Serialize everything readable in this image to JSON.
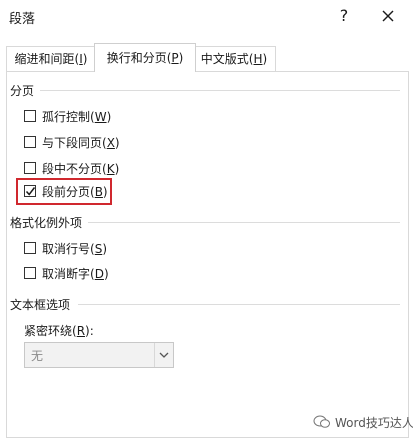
{
  "dialog": {
    "title": "段落",
    "help_label": "?",
    "close_label": "close"
  },
  "tabs": [
    {
      "label": "缩进和间距(I)",
      "active": false
    },
    {
      "label": "换行和分页(P)",
      "active": true
    },
    {
      "label": "中文版式(H)",
      "active": false
    }
  ],
  "pagination": {
    "heading": "分页",
    "options": [
      {
        "label": "孤行控制(W)",
        "checked": false
      },
      {
        "label": "与下段同页(X)",
        "checked": false
      },
      {
        "label": "段中不分页(K)",
        "checked": false
      },
      {
        "label": "段前分页(B)",
        "checked": true
      }
    ]
  },
  "formatting_exceptions": {
    "heading": "格式化例外项",
    "options": [
      {
        "label": "取消行号(S)",
        "checked": false
      },
      {
        "label": "取消断字(D)",
        "checked": false
      }
    ]
  },
  "textbox_options": {
    "heading": "文本框选项",
    "wrap_label": "紧密环绕(R):",
    "wrap_value": "无"
  },
  "watermark": {
    "text": "Word技巧达人"
  },
  "colors": {
    "highlight_border": "#d0282e",
    "checkbox_border": "#333333",
    "disabled_text": "#8a8a8a"
  }
}
